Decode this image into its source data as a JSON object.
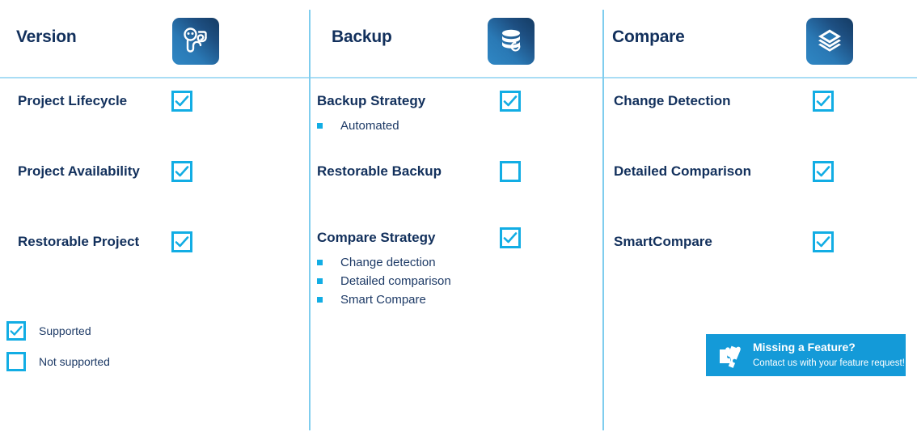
{
  "columns": [
    {
      "title": "Version",
      "icon": "version-fingerprint-icon",
      "features": [
        {
          "label": "Project Lifecycle",
          "supported": true,
          "subitems": []
        },
        {
          "label": "Project Availability",
          "supported": true,
          "subitems": []
        },
        {
          "label": "Restorable Project",
          "supported": true,
          "subitems": []
        }
      ]
    },
    {
      "title": "Backup",
      "icon": "database-restore-icon",
      "features": [
        {
          "label": "Backup Strategy",
          "supported": true,
          "subitems": [
            "Automated"
          ]
        },
        {
          "label": "Restorable Backup",
          "supported": false,
          "subitems": []
        },
        {
          "label": "Compare Strategy",
          "supported": true,
          "subitems": [
            "Change detection",
            "Detailed comparison",
            "Smart Compare"
          ]
        }
      ]
    },
    {
      "title": "Compare",
      "icon": "layers-stack-icon",
      "features": [
        {
          "label": "Change Detection",
          "supported": true,
          "subitems": []
        },
        {
          "label": "Detailed Comparison",
          "supported": true,
          "subitems": []
        },
        {
          "label": "SmartCompare",
          "supported": true,
          "subitems": []
        }
      ]
    }
  ],
  "legend": {
    "supported_label": "Supported",
    "not_supported_label": "Not supported"
  },
  "banner": {
    "title": "Missing a Feature?",
    "subtitle": "Contact us with your feature request!",
    "icon": "puzzle-piece-icon",
    "background_color": "#149ad8"
  },
  "colors": {
    "accent": "#12ade4",
    "text_dark": "#12305c",
    "rule": "#a9ddf5",
    "divider": "#7fcdee"
  }
}
